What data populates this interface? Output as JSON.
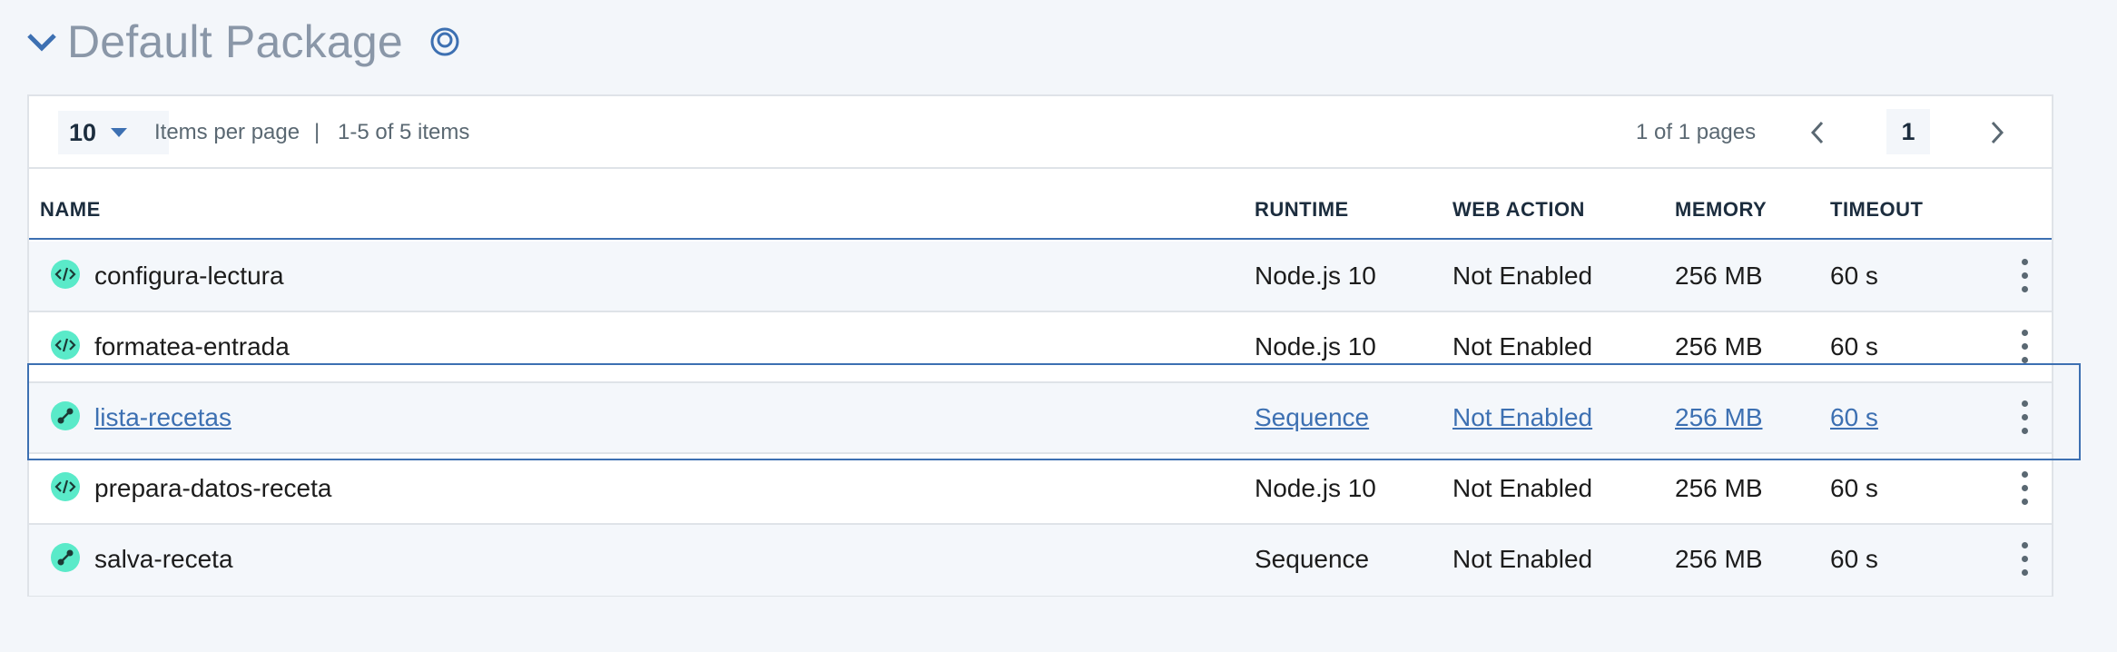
{
  "package": {
    "title": "Default Package",
    "icon": "package-circle-icon"
  },
  "pagination": {
    "per_page": "10",
    "items_per_page_label": "Items per page",
    "separator": "|",
    "range_label": "1-5 of 5 items",
    "pages_label": "1 of 1 pages",
    "current_page": "1"
  },
  "columns": {
    "name": "NAME",
    "runtime": "RUNTIME",
    "web_action": "WEB ACTION",
    "memory": "MEMORY",
    "timeout": "TIMEOUT"
  },
  "rows": [
    {
      "icon": "code-action-icon",
      "name": "configura-lectura",
      "runtime": "Node.js 10",
      "web_action": "Not Enabled",
      "memory": "256 MB",
      "timeout": "60 s"
    },
    {
      "icon": "code-action-icon",
      "name": "formatea-entrada",
      "runtime": "Node.js 10",
      "web_action": "Not Enabled",
      "memory": "256 MB",
      "timeout": "60 s"
    },
    {
      "icon": "sequence-icon",
      "name": "lista-recetas",
      "runtime": "Sequence",
      "web_action": "Not Enabled",
      "memory": "256 MB",
      "timeout": "60 s"
    },
    {
      "icon": "code-action-icon",
      "name": "prepara-datos-receta",
      "runtime": "Node.js 10",
      "web_action": "Not Enabled",
      "memory": "256 MB",
      "timeout": "60 s"
    },
    {
      "icon": "sequence-icon",
      "name": "salva-receta",
      "runtime": "Sequence",
      "web_action": "Not Enabled",
      "memory": "256 MB",
      "timeout": "60 s"
    }
  ],
  "colors": {
    "accent": "#3d70b2",
    "icon_bg": "#5aeac9",
    "title_gray": "#8a97a8"
  }
}
